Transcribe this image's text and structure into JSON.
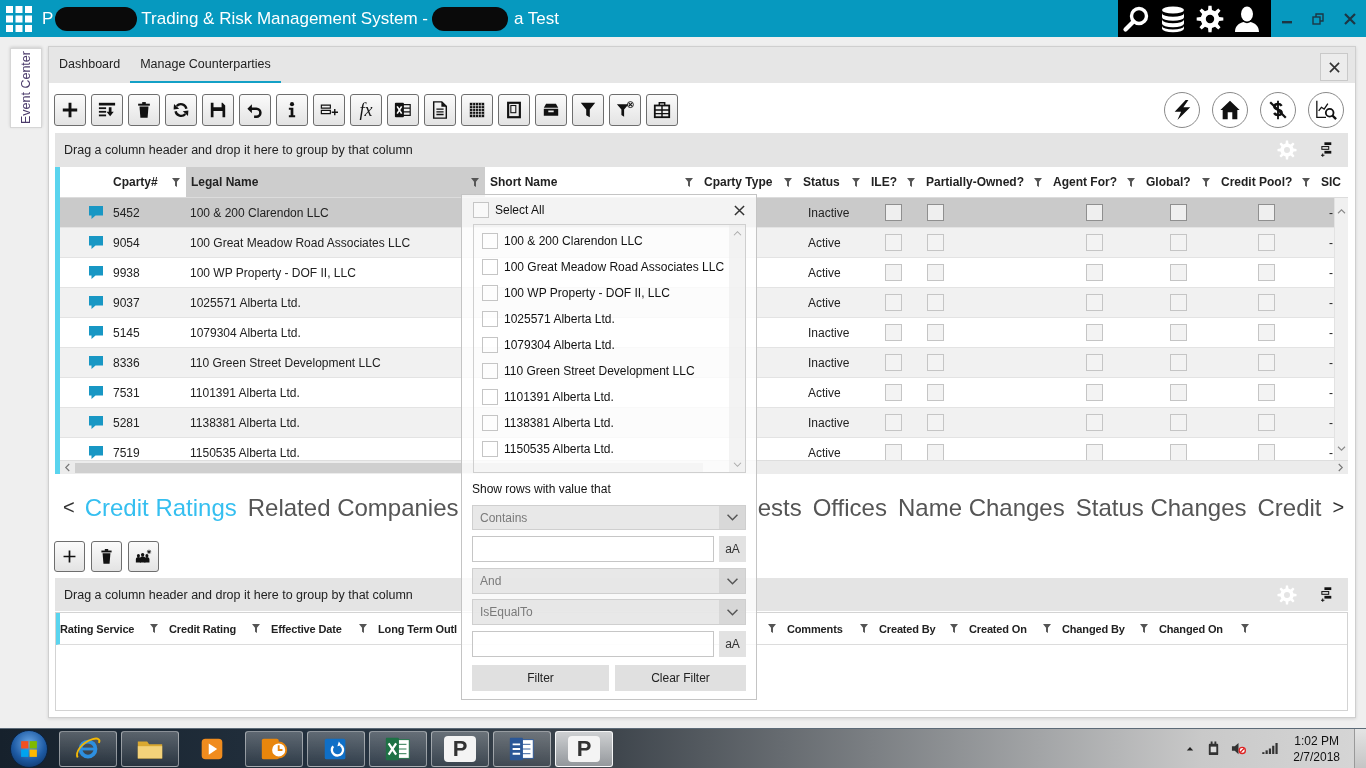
{
  "window": {
    "title_parts": [
      "P",
      "Trading & Risk Management System -",
      "a Test"
    ]
  },
  "side_tab": {
    "label": "Event Center"
  },
  "tabs": [
    {
      "label": "Dashboard",
      "selected": false
    },
    {
      "label": "Manage Counterparties",
      "selected": true
    }
  ],
  "toolbar": {
    "formula_button": "fx"
  },
  "group_panel": {
    "hint": "Drag a column header and drop it here to group by that column"
  },
  "grid": {
    "columns": [
      {
        "label": "Cparty#",
        "highlighted": false
      },
      {
        "label": "Legal Name",
        "highlighted": true
      },
      {
        "label": "Short Name",
        "highlighted": false
      },
      {
        "label": "Cparty Type",
        "highlighted": false
      },
      {
        "label": "Status",
        "highlighted": false
      },
      {
        "label": "ILE?",
        "highlighted": false
      },
      {
        "label": "Partially-Owned?",
        "highlighted": false
      },
      {
        "label": "Agent For?",
        "highlighted": false
      },
      {
        "label": "Global?",
        "highlighted": false
      },
      {
        "label": "Credit Pool?",
        "highlighted": false
      },
      {
        "label": "SIC",
        "highlighted": false
      }
    ],
    "rows": [
      {
        "cparty": "5452",
        "legal_name": "100 & 200 Clarendon LLC",
        "status": "Inactive",
        "ile": false,
        "partially_owned": false,
        "agent_for": false,
        "global": false,
        "credit_pool": false,
        "sic": "-",
        "selected": true
      },
      {
        "cparty": "9054",
        "legal_name": "100 Great Meadow Road Associates LLC",
        "status": "Active",
        "ile": false,
        "partially_owned": false,
        "agent_for": false,
        "global": false,
        "credit_pool": false,
        "sic": "-",
        "selected": false
      },
      {
        "cparty": "9938",
        "legal_name": "100 WP Property - DOF II, LLC",
        "status": "Active",
        "ile": false,
        "partially_owned": false,
        "agent_for": false,
        "global": false,
        "credit_pool": false,
        "sic": "-",
        "selected": false
      },
      {
        "cparty": "9037",
        "legal_name": "1025571 Alberta Ltd.",
        "status": "Active",
        "ile": false,
        "partially_owned": false,
        "agent_for": false,
        "global": false,
        "credit_pool": false,
        "sic": "-",
        "selected": false
      },
      {
        "cparty": "5145",
        "legal_name": "1079304 Alberta Ltd.",
        "status": "Inactive",
        "ile": false,
        "partially_owned": false,
        "agent_for": false,
        "global": false,
        "credit_pool": false,
        "sic": "-",
        "selected": false
      },
      {
        "cparty": "8336",
        "legal_name": "110 Green Street Development LLC",
        "status": "Inactive",
        "ile": false,
        "partially_owned": false,
        "agent_for": false,
        "global": false,
        "credit_pool": false,
        "sic": "-",
        "selected": false
      },
      {
        "cparty": "7531",
        "legal_name": "1101391 Alberta Ltd.",
        "status": "Active",
        "ile": false,
        "partially_owned": false,
        "agent_for": false,
        "global": false,
        "credit_pool": false,
        "sic": "-",
        "selected": false
      },
      {
        "cparty": "5281",
        "legal_name": "1138381 Alberta Ltd.",
        "status": "Inactive",
        "ile": false,
        "partially_owned": false,
        "agent_for": false,
        "global": false,
        "credit_pool": false,
        "sic": "-",
        "selected": false
      },
      {
        "cparty": "7519",
        "legal_name": "1150535 Alberta Ltd.",
        "status": "Active",
        "ile": false,
        "partially_owned": false,
        "agent_for": false,
        "global": false,
        "credit_pool": false,
        "sic": "-",
        "selected": false
      }
    ]
  },
  "filter_popup": {
    "select_all": {
      "label": "Select All",
      "checked": false
    },
    "items": [
      {
        "label": "100 & 200 Clarendon LLC",
        "checked": false
      },
      {
        "label": "100 Great Meadow Road Associates LLC",
        "checked": false
      },
      {
        "label": "100 WP Property - DOF II, LLC",
        "checked": false
      },
      {
        "label": "1025571 Alberta Ltd.",
        "checked": false
      },
      {
        "label": "1079304 Alberta Ltd.",
        "checked": false
      },
      {
        "label": "110 Green Street Development LLC",
        "checked": false
      },
      {
        "label": "1101391 Alberta Ltd.",
        "checked": false
      },
      {
        "label": "1138381 Alberta Ltd.",
        "checked": false
      },
      {
        "label": "1150535 Alberta Ltd.",
        "checked": false
      }
    ],
    "prompt": "Show rows with value that",
    "conditions": [
      {
        "operator": "Contains",
        "case_toggle": "aA"
      },
      {
        "operator": "IsEqualTo",
        "case_toggle": "aA"
      }
    ],
    "logic": "And",
    "buttons": [
      "Filter",
      "Clear Filter"
    ]
  },
  "detail_tabs": {
    "previous": "<",
    "next": ">",
    "items": [
      {
        "label": "Credit Ratings",
        "selected": true
      },
      {
        "label": "Related Companies",
        "selected": false
      },
      {
        "label": "ests",
        "selected": false
      },
      {
        "label": "Offices",
        "selected": false
      },
      {
        "label": "Name Changes",
        "selected": false
      },
      {
        "label": "Status Changes",
        "selected": false
      },
      {
        "label": "Credit",
        "selected": false
      }
    ]
  },
  "detail_group_panel": {
    "hint": "Drag a column header and drop it here to group by that column"
  },
  "detail_grid": {
    "columns": [
      "Rating Service",
      "Credit Rating",
      "Effective Date",
      "Long Term Outl",
      "Comments",
      "Created By",
      "Created On",
      "Changed By",
      "Changed On"
    ]
  },
  "taskbar": {
    "apps": [
      {
        "running": true,
        "selected": false
      },
      {
        "running": true,
        "selected": false
      },
      {
        "running": false,
        "selected": false
      },
      {
        "running": true,
        "selected": false
      },
      {
        "running": true,
        "selected": false
      },
      {
        "running": true,
        "selected": false
      },
      {
        "running": true,
        "selected": false,
        "logo_text": "P"
      },
      {
        "running": true,
        "selected": false
      },
      {
        "running": true,
        "selected": true,
        "logo_text": "P"
      }
    ],
    "clock": {
      "time": "1:02 PM",
      "date": "2/7/2018"
    }
  }
}
